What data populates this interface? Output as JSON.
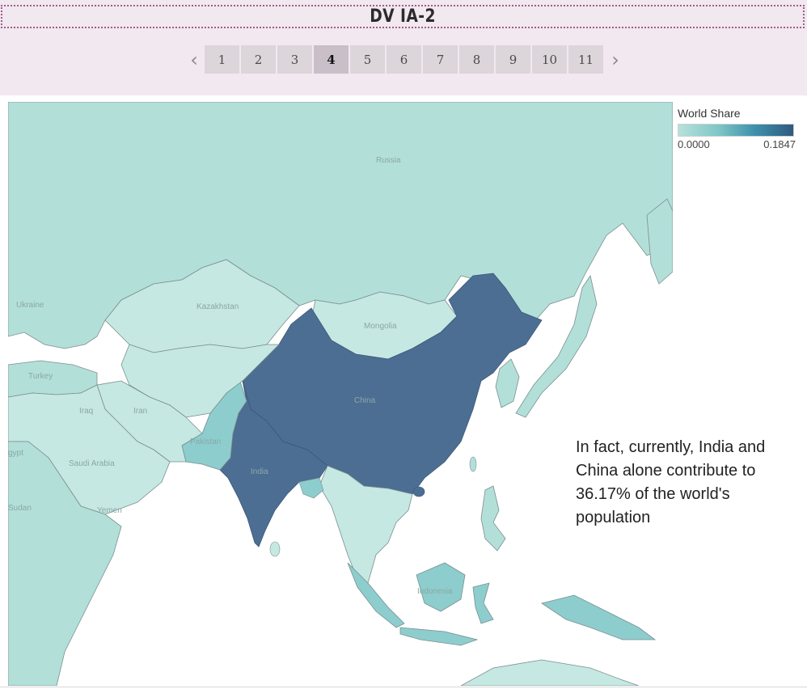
{
  "header": {
    "title": "DV IA-2"
  },
  "pager": {
    "prev_icon": "chevron-left-icon",
    "next_icon": "chevron-right-icon",
    "prev_glyph": "‹",
    "next_glyph": "›",
    "active": "4",
    "pages": [
      "1",
      "2",
      "3",
      "4",
      "5",
      "6",
      "7",
      "8",
      "9",
      "10",
      "11"
    ]
  },
  "legend": {
    "title": "World Share",
    "min": "0.0000",
    "max": "0.1847",
    "color_low": "#b6e2dc",
    "color_high": "#2f5a80"
  },
  "map": {
    "region": "Asia",
    "labels": {
      "russia": "Russia",
      "kazakhstan": "Kazakhstan",
      "mongolia": "Mongolia",
      "china": "China",
      "india": "India",
      "iran": "Iran",
      "iraq": "Iraq",
      "turkey": "Turkey",
      "saudi": "Saudi Arabia",
      "egypt": "gypt",
      "sudan": "Sudan",
      "yemen": "Yemen",
      "pakistan": "Pakistan",
      "ukraine": "Ukraine",
      "indonesia": "Indonesia"
    },
    "highlight_color": "#4d6e93",
    "base_color": "#b3dfd9",
    "light_color": "#c5e8e2",
    "mid_color": "#8dcdcd"
  },
  "annotation": {
    "text": "In fact, currently, India and China alone contribute to 36.17% of the world's population"
  }
}
